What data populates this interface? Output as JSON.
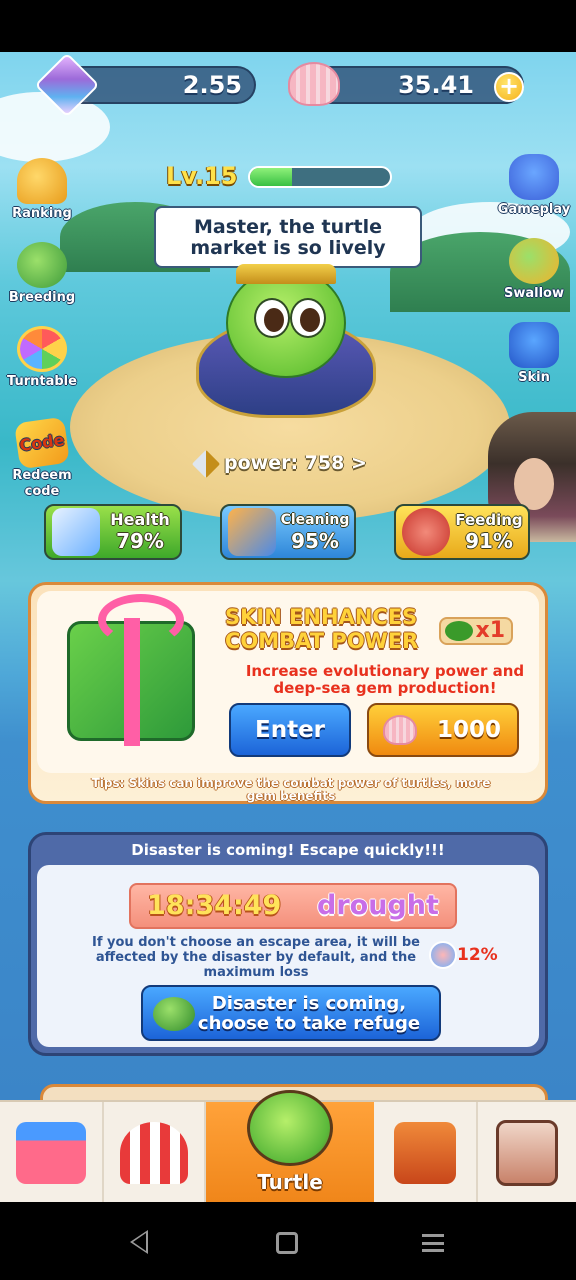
{
  "currency": {
    "gems": "2.55",
    "shells": "35.41",
    "add_symbol": "+"
  },
  "level": {
    "label": "Lv.15",
    "progress_fraction": 0.3
  },
  "speech_bubble": "Master, the turtle market is so lively",
  "side_left": [
    {
      "label": "Ranking",
      "icon": "trophy-icon"
    },
    {
      "label": "Breeding",
      "icon": "breeding-turtle-icon"
    },
    {
      "label": "Turntable",
      "icon": "wheel-icon"
    },
    {
      "label": "Redeem code",
      "icon": "code-coupon-icon",
      "icon_text": "Code"
    }
  ],
  "side_right": [
    {
      "label": "Gameplay",
      "icon": "gamepad-icon"
    },
    {
      "label": "Swallow",
      "icon": "swallow-turtle-icon"
    },
    {
      "label": "Skin",
      "icon": "outfit-icon"
    }
  ],
  "power": {
    "label": "power: 758 >"
  },
  "stats": {
    "health": {
      "label": "Health",
      "value": "79%"
    },
    "cleaning": {
      "label": "Cleaning",
      "value": "95%"
    },
    "feeding": {
      "label": "Feeding",
      "value": "91%"
    }
  },
  "skin_card": {
    "title_line1": "SKIN ENHANCES",
    "title_line2": "COMBAT POWER",
    "multiplier": "x1",
    "description": "Increase evolutionary power and deep-sea gem production!",
    "enter_label": "Enter",
    "price": "1000",
    "tips": "Tips: Skins can improve the combat power of turtles, more gem benefits"
  },
  "disaster_card": {
    "header": "Disaster is coming! Escape quickly!!!",
    "timer": "18:34:49",
    "type": "drought",
    "description": "If you don't choose an escape area, it will be affected by the disaster by default, and the maximum loss",
    "loss": "12%",
    "refuge_button": "Disaster is coming, choose to take refuge"
  },
  "bottom_nav": {
    "items": [
      {
        "name": "shop",
        "icon": "shop-icon"
      },
      {
        "name": "circus",
        "icon": "circus-tent-icon"
      },
      {
        "name": "turtle",
        "label": "Turtle",
        "icon": "turtle-icon",
        "active": true
      },
      {
        "name": "bag",
        "icon": "backpack-icon"
      },
      {
        "name": "records",
        "icon": "contact-book-icon"
      }
    ]
  },
  "colors": {
    "accent_orange": "#f0861a",
    "button_blue": "#1c64d8",
    "warning_red": "#e8311e"
  }
}
